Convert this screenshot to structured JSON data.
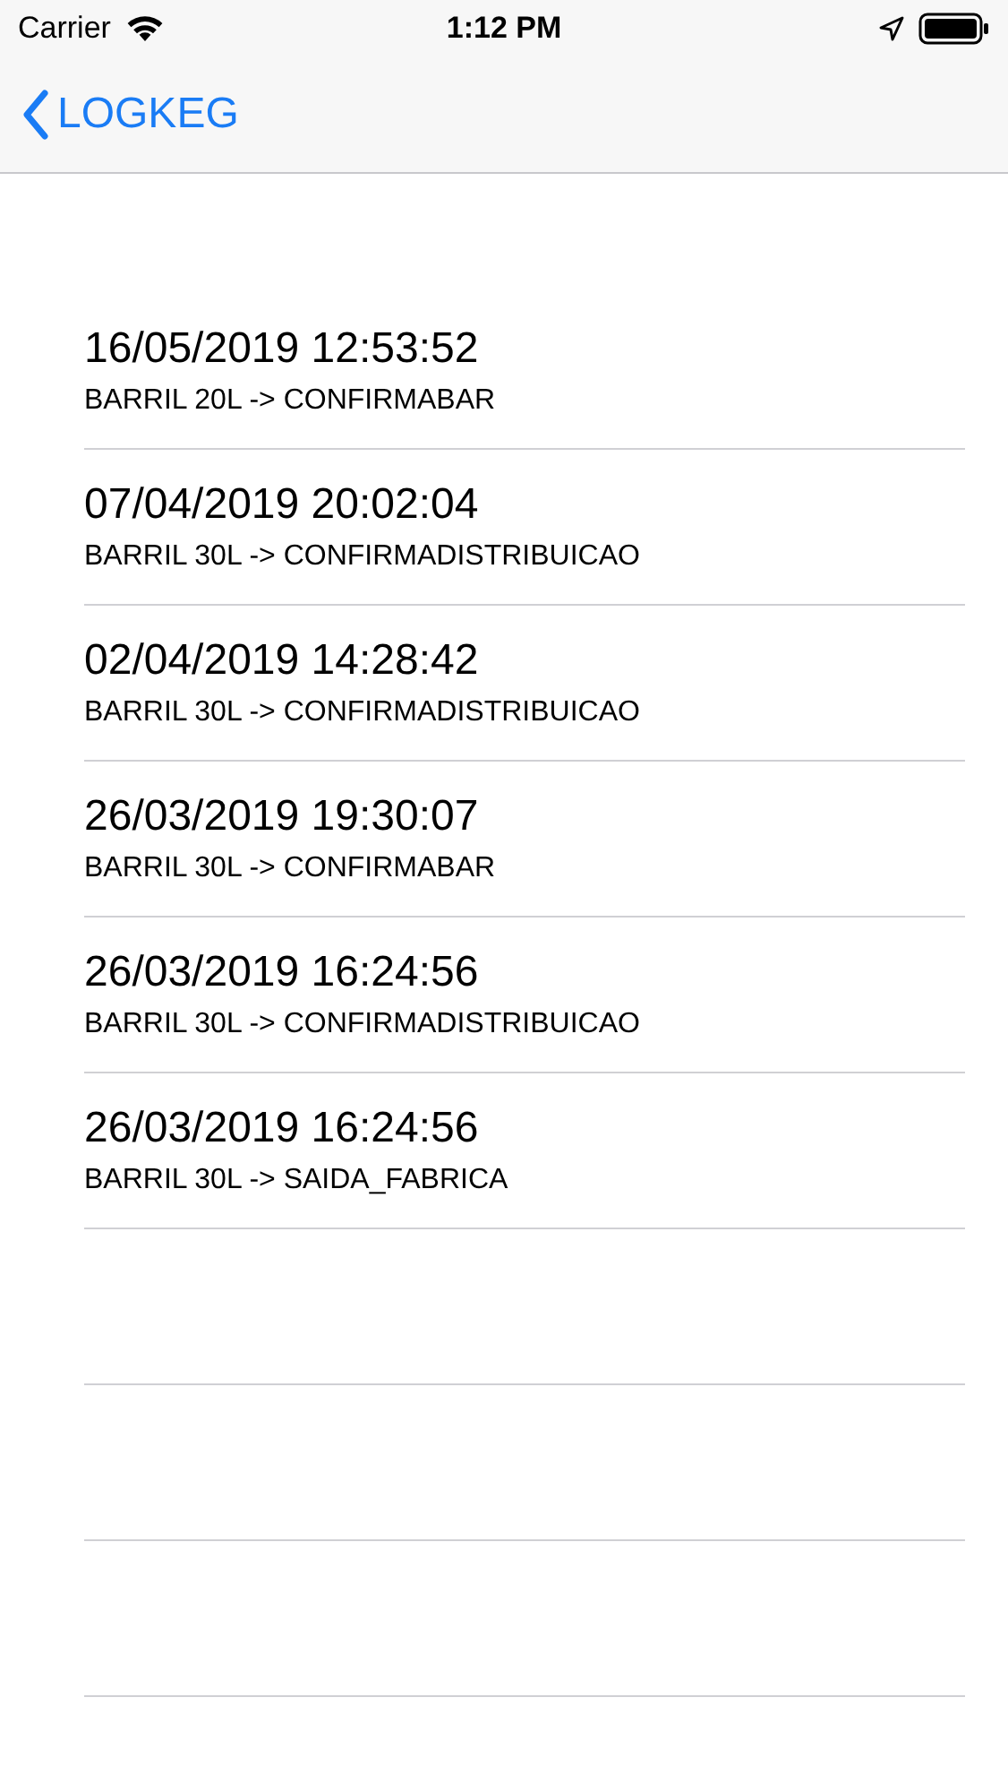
{
  "status_bar": {
    "carrier": "Carrier",
    "time": "1:12 PM"
  },
  "nav_bar": {
    "back_label": "LOGKEG"
  },
  "log_entries": [
    {
      "timestamp": "16/05/2019 12:53:52",
      "event": "BARRIL 20L -> CONFIRMABAR"
    },
    {
      "timestamp": "07/04/2019 20:02:04",
      "event": "BARRIL 30L -> CONFIRMADISTRIBUICAO"
    },
    {
      "timestamp": "02/04/2019 14:28:42",
      "event": "BARRIL 30L -> CONFIRMADISTRIBUICAO"
    },
    {
      "timestamp": "26/03/2019 19:30:07",
      "event": "BARRIL 30L -> CONFIRMABAR"
    },
    {
      "timestamp": "26/03/2019 16:24:56",
      "event": "BARRIL 30L -> CONFIRMADISTRIBUICAO"
    },
    {
      "timestamp": "26/03/2019 16:24:56",
      "event": "BARRIL 30L -> SAIDA_FABRICA"
    }
  ]
}
